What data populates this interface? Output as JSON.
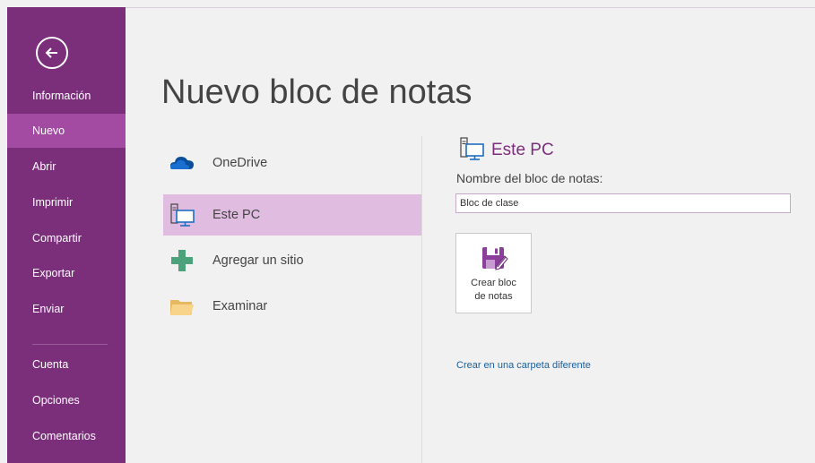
{
  "sidebar": {
    "items": [
      {
        "label": "Información"
      },
      {
        "label": "Nuevo"
      },
      {
        "label": "Abrir"
      },
      {
        "label": "Imprimir"
      },
      {
        "label": "Compartir"
      },
      {
        "label": "Exportar"
      },
      {
        "label": "Enviar"
      },
      {
        "label": "Cuenta"
      },
      {
        "label": "Opciones"
      },
      {
        "label": "Comentarios"
      }
    ],
    "active_item": "Nuevo",
    "back_icon": "back-arrow-icon"
  },
  "main": {
    "title": "Nuevo bloc de notas",
    "places": [
      {
        "label": "OneDrive",
        "icon": "cloud-icon"
      },
      {
        "label": "Este PC",
        "icon": "computer-icon"
      },
      {
        "label": "Agregar un sitio",
        "icon": "plus-icon"
      },
      {
        "label": "Examinar",
        "icon": "folder-icon"
      }
    ],
    "selected_place": "Este PC"
  },
  "detail": {
    "title": "Este PC",
    "name_label": "Nombre del bloc de notas:",
    "name_value": "Bloc de clase",
    "create_label_line1": "Crear bloc",
    "create_label_line2": "de notas",
    "create_icon": "save-icon",
    "alt_link": "Crear en una carpeta diferente"
  },
  "colors": {
    "brand": "#7b2f7b",
    "nav_active": "#a34aa3",
    "selected_place": "#e0bde0",
    "link": "#1a5e9a"
  }
}
